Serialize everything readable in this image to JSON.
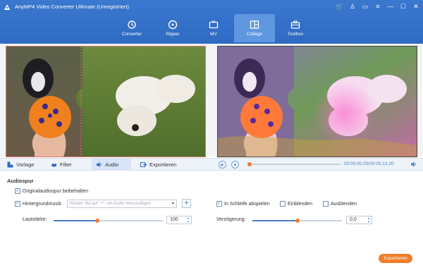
{
  "app": {
    "title": "AnyMP4 Video Converter Ultimate (Unregistriert)"
  },
  "window_controls": [
    {
      "icon": "cart-icon",
      "glyph": "🛒"
    },
    {
      "icon": "user-icon",
      "glyph": "♙"
    },
    {
      "icon": "chat-icon",
      "glyph": "▭"
    },
    {
      "icon": "menu-icon",
      "glyph": "≡"
    },
    {
      "icon": "minimize-icon",
      "glyph": "—"
    },
    {
      "icon": "maximize-icon",
      "glyph": "☐"
    },
    {
      "icon": "close-icon",
      "glyph": "✕"
    }
  ],
  "nav": [
    {
      "label": "Converter",
      "icon": "converter-icon"
    },
    {
      "label": "Ripper",
      "icon": "ripper-icon"
    },
    {
      "label": "MV",
      "icon": "mv-icon"
    },
    {
      "label": "Collage",
      "icon": "collage-icon",
      "active": true
    },
    {
      "label": "Toolbox",
      "icon": "toolbox-icon"
    }
  ],
  "toolbar": {
    "template": "Vorlage",
    "filter": "Filter",
    "audio": "Audio",
    "export": "Exportieren"
  },
  "player": {
    "current_time": "00:00:00.00",
    "total_time": "00:00:13.20",
    "progress": 0.0
  },
  "audio": {
    "section_title": "Audiospur",
    "keep_original": {
      "label": "Originalaudiospur beibehalten",
      "checked": true
    },
    "background_music": {
      "label": "Hintergrundmusik",
      "checked": true,
      "placeholder": "Klicken Sie auf \"+\", um Audio hinzuzufügen"
    },
    "loop": {
      "label": "In Schleife abspielen",
      "checked": true
    },
    "fade_in": {
      "label": "Einblenden",
      "checked": false
    },
    "fade_out": {
      "label": "Ausblenden",
      "checked": false
    },
    "volume": {
      "label": "Lautstärke:",
      "value": "100",
      "level": 0.4
    },
    "delay": {
      "label": "Verzögerung:",
      "value": "0,0",
      "level": 0.5
    }
  },
  "export_button": "Exportieren",
  "colors": {
    "brand": "#2f6ac3",
    "accent": "#f07d2a"
  }
}
